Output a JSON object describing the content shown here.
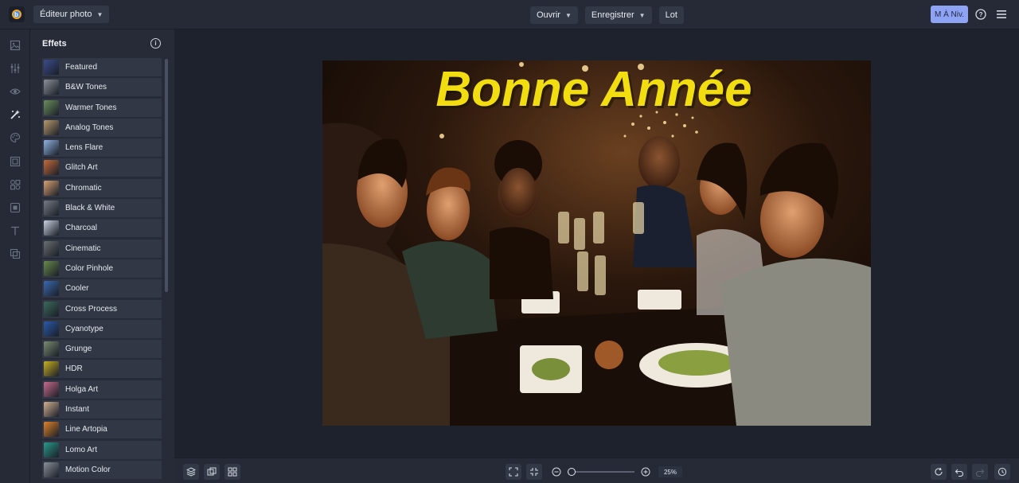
{
  "header": {
    "editor_label": "Éditeur photo",
    "open_label": "Ouvrir",
    "save_label": "Enregistrer",
    "batch_label": "Lot",
    "upgrade_label": "M À Niv."
  },
  "panel": {
    "title": "Effets",
    "items": [
      {
        "label": "Featured",
        "color": "#3b4c8c"
      },
      {
        "label": "B&W Tones",
        "color": "#8a8f98"
      },
      {
        "label": "Warmer Tones",
        "color": "#6b8f5a"
      },
      {
        "label": "Analog Tones",
        "color": "#b89a6a"
      },
      {
        "label": "Lens Flare",
        "color": "#8fb3e0"
      },
      {
        "label": "Glitch Art",
        "color": "#c46a3a"
      },
      {
        "label": "Chromatic",
        "color": "#d9a070"
      },
      {
        "label": "Black & White",
        "color": "#777b82"
      },
      {
        "label": "Charcoal",
        "color": "#c9d0e0"
      },
      {
        "label": "Cinematic",
        "color": "#6a6f70"
      },
      {
        "label": "Color Pinhole",
        "color": "#6a8a4a"
      },
      {
        "label": "Cooler",
        "color": "#3a6ab0"
      },
      {
        "label": "Cross Process",
        "color": "#3a6a5a"
      },
      {
        "label": "Cyanotype",
        "color": "#2a5aa8"
      },
      {
        "label": "Grunge",
        "color": "#7a8a70"
      },
      {
        "label": "HDR",
        "color": "#c8b020"
      },
      {
        "label": "Holga Art",
        "color": "#c86a8a"
      },
      {
        "label": "Instant",
        "color": "#d0b090"
      },
      {
        "label": "Line Artopia",
        "color": "#e0822a"
      },
      {
        "label": "Lomo Art",
        "color": "#2a9a8a"
      },
      {
        "label": "Motion Color",
        "color": "#8a8f98"
      }
    ]
  },
  "canvas": {
    "overlay_text": "Bonne Année",
    "overlay_color": "#f2de10"
  },
  "zoom": {
    "value": "25%"
  },
  "colors": {
    "accent": "#8fa3f5",
    "background": "#1f2430"
  }
}
